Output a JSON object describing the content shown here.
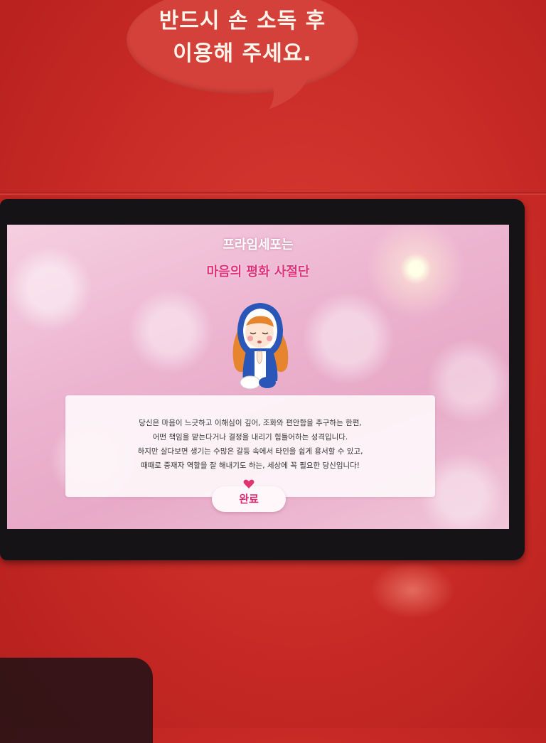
{
  "sign": {
    "line1": "반드시 손 소독 후",
    "line2": "이용해 주세요."
  },
  "screen": {
    "pretitle": "프라임세포는",
    "title": "마음의 평화 사절단",
    "character_icon": "praying-girl-character-icon",
    "description": [
      "당신은 마음이 느긋하고 이해심이 깊어, 조화와 편안함을 추구하는 한편,",
      "어떤 책임을 맡는다거나 결정을 내리기 힘들어하는 성격입니다.",
      "하지만 살다보면 생기는 수많은 갈등 속에서 타인을 쉽게 용서할 수 있고,",
      "때때로 중재자 역할을 잘 해내기도 하는, 세상에 꼭 필요한 당신입니다!"
    ],
    "done_label": "완료",
    "heart_icon": "heart-icon"
  },
  "colors": {
    "cabinet_red": "#c82a26",
    "bubble_red": "#d4403a",
    "title_pink": "#e0307a",
    "button_text_pink": "#d92f74"
  }
}
